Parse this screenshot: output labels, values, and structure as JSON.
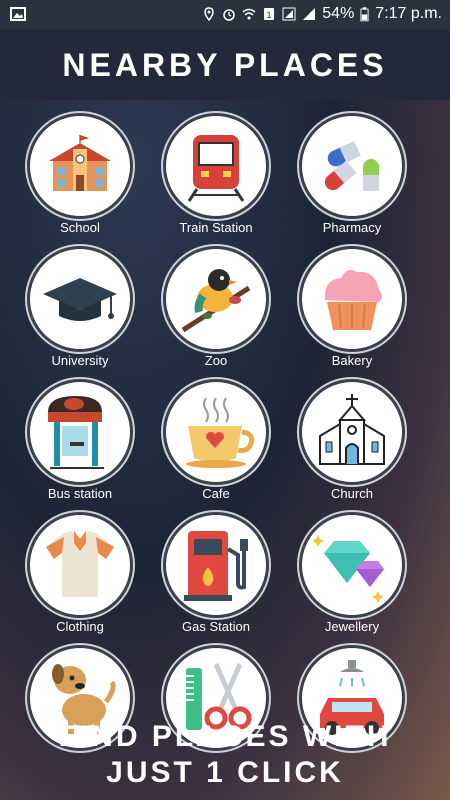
{
  "status": {
    "battery": "54%",
    "time": "7:17 p.m.",
    "icons": [
      "photo-icon",
      "location-icon",
      "alarm-icon",
      "wifi-icon",
      "sim1-icon",
      "signal-icon",
      "battery-icon"
    ]
  },
  "header": {
    "title": "NEARBY PLACES"
  },
  "places": [
    {
      "label": "School",
      "icon": "school-icon"
    },
    {
      "label": "Train Station",
      "icon": "train-icon"
    },
    {
      "label": "Pharmacy",
      "icon": "pills-icon"
    },
    {
      "label": "University",
      "icon": "graduation-cap-icon"
    },
    {
      "label": "Zoo",
      "icon": "bird-icon"
    },
    {
      "label": "Bakery",
      "icon": "cupcake-icon"
    },
    {
      "label": "Bus station",
      "icon": "bus-stop-icon"
    },
    {
      "label": "Cafe",
      "icon": "coffee-cup-icon"
    },
    {
      "label": "Church",
      "icon": "church-icon"
    },
    {
      "label": "Clothing",
      "icon": "shirt-icon"
    },
    {
      "label": "Gas Station",
      "icon": "gas-pump-icon"
    },
    {
      "label": "Jewellery",
      "icon": "diamond-icon"
    },
    {
      "label": "",
      "icon": "dog-icon"
    },
    {
      "label": "",
      "icon": "comb-scissors-icon"
    },
    {
      "label": "",
      "icon": "car-wash-icon"
    }
  ],
  "banner": {
    "line1": "FIND PLACES WITH",
    "line2": "JUST 1 CLICK"
  },
  "colors": {
    "statusbar": "#2a313f",
    "titlebar": "#23293a",
    "accent": "#ffffff"
  }
}
